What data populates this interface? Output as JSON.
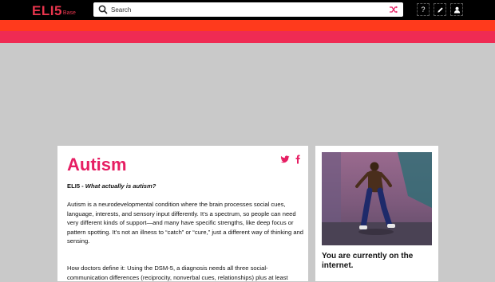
{
  "header": {
    "logo_main": "ELI5",
    "logo_sub": "Base",
    "search_placeholder": "Search",
    "buttons": {
      "help_label": "?"
    }
  },
  "colors": {
    "topbar": "#000000",
    "band_top": "#ff3a1c",
    "band_bottom": "#ef2b53",
    "accent": "#e61e63",
    "page_bg": "#c9c9c9"
  },
  "icons": [
    "search-icon",
    "shuffle-icon",
    "pencil-icon",
    "user-icon",
    "twitter-icon",
    "facebook-icon"
  ],
  "article": {
    "title": "Autism",
    "subtitle_prefix": "ELI5 - ",
    "subtitle_question": "What actually is autism?",
    "paragraph1": "Autism is a neurodevelopmental condition where the brain processes social cues, language, interests, and sensory input differently. It’s a spectrum, so people can need very different kinds of support—and many have specific strengths, like deep focus or pattern spotting. It’s not an illness to “catch” or “cure,” just a different way of thinking and sensing.",
    "paragraph2": "How doctors define it: Using the DSM-5, a diagnosis needs all three social-communication differences (reciprocity, nonverbal cues, relationships) plus at least"
  },
  "sidebar": {
    "caption": "You are currently on the internet."
  }
}
